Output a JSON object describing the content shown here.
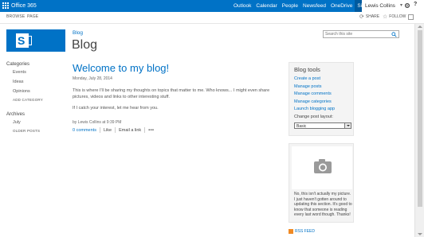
{
  "suite_bar": {
    "brand": "Office 365",
    "links": [
      {
        "label": "Outlook",
        "active": false
      },
      {
        "label": "Calendar",
        "active": false
      },
      {
        "label": "People",
        "active": false
      },
      {
        "label": "Newsfeed",
        "active": false
      },
      {
        "label": "OneDrive",
        "active": false
      },
      {
        "label": "Sites",
        "active": true
      }
    ],
    "user_name": "Lewis Collins",
    "colors": {
      "bar": "#0072c6",
      "active": "#005a9e"
    }
  },
  "ribbon": {
    "browse": "BROWSE",
    "page": "PAGE",
    "share": "SHARE",
    "follow": "FOLLOW"
  },
  "header": {
    "breadcrumb": "Blog",
    "title": "Blog",
    "search_placeholder": "Search this site"
  },
  "left_nav": {
    "categories_heading": "Categories",
    "categories": [
      "Events",
      "Ideas",
      "Opinions"
    ],
    "add_category": "ADD CATEGORY",
    "archives_heading": "Archives",
    "archives": [
      "July"
    ],
    "older_posts": "OLDER POSTS"
  },
  "post": {
    "title": "Welcome to my blog!",
    "date": "Monday, July 28, 2014",
    "paragraphs": [
      "This is where I'll be sharing my thoughts on topics that matter to me. Who knows... I might even share pictures, videos and links to other interesting stuff.",
      "If I catch your interest, let me hear from you."
    ],
    "meta": "by Lewis Collins at 9:39 PM",
    "comments": "0 comments",
    "like": "Like",
    "email": "Email a link",
    "more": "•••"
  },
  "blog_tools": {
    "title": "Blog tools",
    "links": [
      "Create a post",
      "Manage posts",
      "Manage comments",
      "Manage categories",
      "Launch blogging app"
    ],
    "layout_label": "Change post layout:",
    "layout_value": "Basic"
  },
  "about": {
    "text": "No, this isn't actually my picture. I just haven't gotten around to updating this section. It's good to know that someone is reading every last word though. Thanks!",
    "rss": "RSS FEED"
  }
}
